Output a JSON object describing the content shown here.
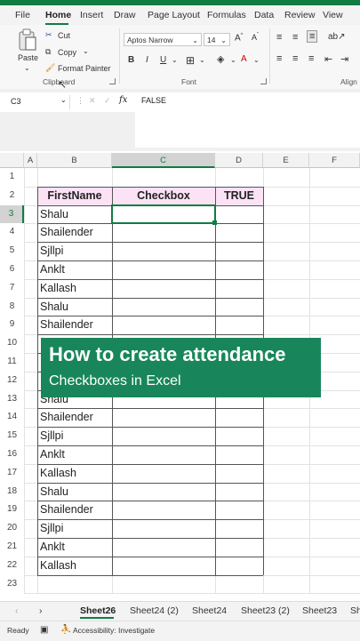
{
  "menu_tabs": [
    "File",
    "Home",
    "Insert",
    "Draw",
    "Page Layout",
    "Formulas",
    "Data",
    "Review",
    "View"
  ],
  "ribbon": {
    "clipboard": {
      "paste": "Paste",
      "cut": "Cut",
      "copy": "Copy",
      "format_painter": "Format Painter",
      "label": "Clipboard"
    },
    "font": {
      "font_name": "Aptos Narrow",
      "font_size": "14",
      "bold": "B",
      "italic": "I",
      "underline": "U",
      "label": "Font"
    },
    "alignment": {
      "label": "Align"
    }
  },
  "formula_bar": {
    "name_box": "C3",
    "fx": "fx",
    "value": "FALSE"
  },
  "columns": [
    "A",
    "B",
    "C",
    "D",
    "E",
    "F"
  ],
  "rows": [
    "1",
    "2",
    "3",
    "4",
    "5",
    "6",
    "7",
    "8",
    "9",
    "10",
    "11",
    "12",
    "13",
    "14",
    "15",
    "16",
    "17",
    "18",
    "19",
    "20",
    "21",
    "22",
    "23"
  ],
  "table": {
    "headers": [
      "FirstName",
      "Checkbox",
      "TRUE"
    ],
    "names": [
      "Shalu",
      "Shailender",
      "Sjllpi",
      "Anklt",
      "Kallash",
      "Shalu",
      "Shailender",
      "",
      "",
      "",
      "Shalu",
      "Shailender",
      "Sjllpi",
      "Anklt",
      "Kallash",
      "Shalu",
      "Shailender",
      "Sjllpi",
      "Anklt",
      "Kallash"
    ]
  },
  "overlay": {
    "title": "How to create attendance",
    "subtitle": "Checkboxes in Excel"
  },
  "sheet_tabs": [
    "Sheet26",
    "Sheet24 (2)",
    "Sheet24",
    "Sheet23 (2)",
    "Sheet23",
    "Sh"
  ],
  "status": {
    "ready": "Ready",
    "accessibility": "Accessibility: Investigate"
  },
  "colors": {
    "accent": "#107c41",
    "header_fill": "#fbe2f4",
    "banner": "#18865a"
  }
}
